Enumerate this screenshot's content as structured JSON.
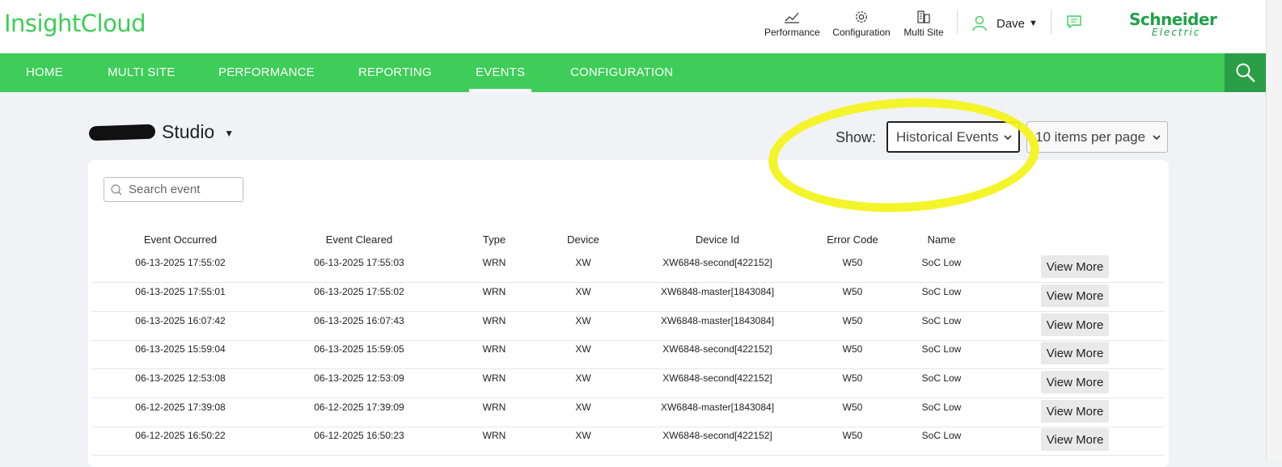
{
  "header": {
    "logo": "InsightCloud",
    "quick_links": [
      {
        "label": "Performance",
        "icon": "chart-line-icon"
      },
      {
        "label": "Configuration",
        "icon": "gear-icon"
      },
      {
        "label": "Multi Site",
        "icon": "buildings-icon"
      }
    ],
    "user_name": "Dave",
    "brand_line1": "Schneider",
    "brand_line2": "Electric"
  },
  "nav": {
    "items": [
      "HOME",
      "MULTI SITE",
      "PERFORMANCE",
      "REPORTING",
      "EVENTS",
      "CONFIGURATION"
    ],
    "active": "EVENTS"
  },
  "site": {
    "name": "Studio"
  },
  "controls": {
    "show_label": "Show:",
    "show_value": "Historical Events",
    "per_page_value": "10 items per page"
  },
  "search": {
    "placeholder": "Search event"
  },
  "table": {
    "headers": [
      "Event Occurred",
      "Event Cleared",
      "Type",
      "Device",
      "Device Id",
      "Error Code",
      "Name"
    ],
    "action_label": "View More",
    "rows": [
      [
        "06-13-2025 17:55:02",
        "06-13-2025 17:55:03",
        "WRN",
        "XW",
        "XW6848-second[422152]",
        "W50",
        "SoC Low"
      ],
      [
        "06-13-2025 17:55:01",
        "06-13-2025 17:55:02",
        "WRN",
        "XW",
        "XW6848-master[1843084]",
        "W50",
        "SoC Low"
      ],
      [
        "06-13-2025 16:07:42",
        "06-13-2025 16:07:43",
        "WRN",
        "XW",
        "XW6848-master[1843084]",
        "W50",
        "SoC Low"
      ],
      [
        "06-13-2025 15:59:04",
        "06-13-2025 15:59:05",
        "WRN",
        "XW",
        "XW6848-second[422152]",
        "W50",
        "SoC Low"
      ],
      [
        "06-13-2025 12:53:08",
        "06-13-2025 12:53:09",
        "WRN",
        "XW",
        "XW6848-second[422152]",
        "W50",
        "SoC Low"
      ],
      [
        "06-12-2025 17:39:08",
        "06-12-2025 17:39:09",
        "WRN",
        "XW",
        "XW6848-master[1843084]",
        "W50",
        "SoC Low"
      ],
      [
        "06-12-2025 16:50:22",
        "06-12-2025 16:50:23",
        "WRN",
        "XW",
        "XW6848-second[422152]",
        "W50",
        "SoC Low"
      ]
    ]
  },
  "colors": {
    "brand_green": "#3dcd58",
    "brand_dark_green": "#1ea048",
    "highlight_yellow": "#f3f31f"
  }
}
